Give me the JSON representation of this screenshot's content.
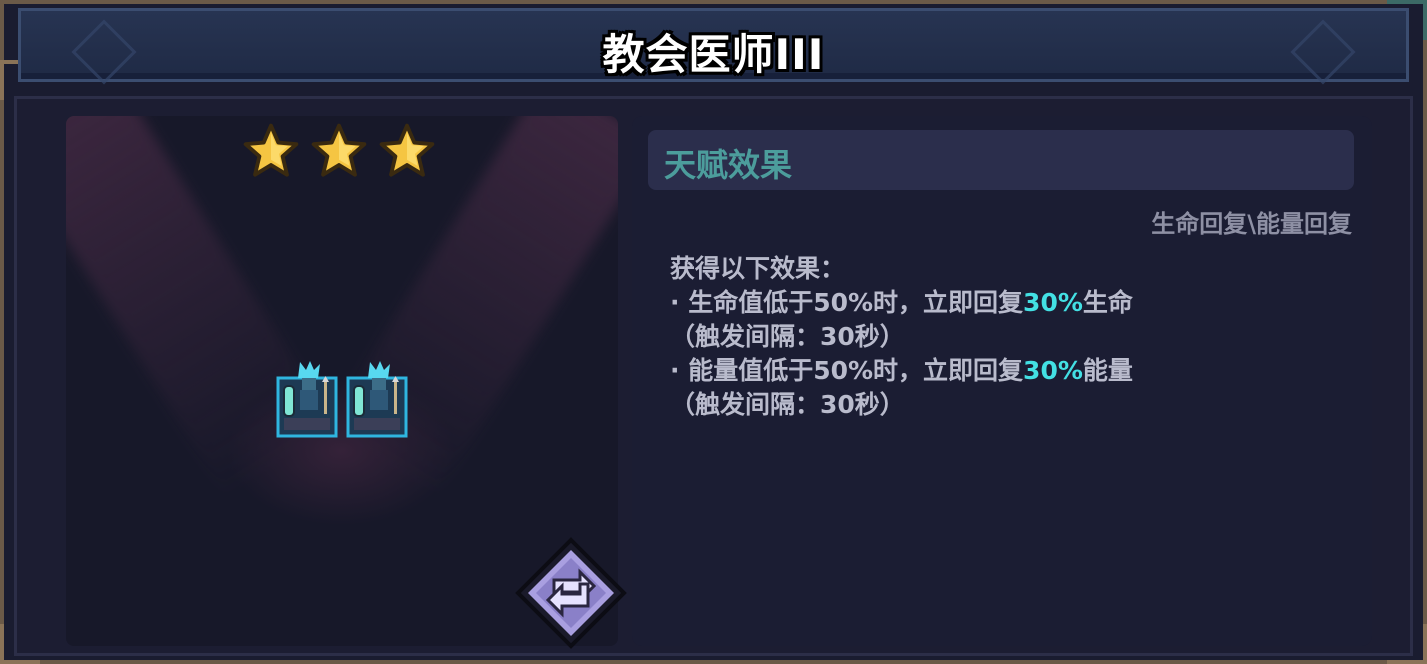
{
  "window": {
    "title": "教会医师III"
  },
  "showcase": {
    "star_rating": 3,
    "star_max": 3,
    "unit_count": 2,
    "icons": [
      "star-icon",
      "healer-unit-icon",
      "refresh-icon"
    ]
  },
  "talent": {
    "header": "天赋效果",
    "tags": "生命回复\\能量回复",
    "intro": "获得以下效果：",
    "effect1_prefix": "· 生命值低于50%时，立即回复",
    "effect1_value": "30%",
    "effect1_suffix": "生命",
    "effect1_interval": "（触发间隔：30秒）",
    "effect2_prefix": "· 能量值低于50%时，立即回复",
    "effect2_value": "30%",
    "effect2_suffix": "能量",
    "effect2_interval": "（触发间隔：30秒）"
  },
  "colors": {
    "highlight": "#43e0e4",
    "header_text": "#4c9d9c",
    "body_text": "#b9bbcc",
    "star_gold": "#f5c542"
  }
}
